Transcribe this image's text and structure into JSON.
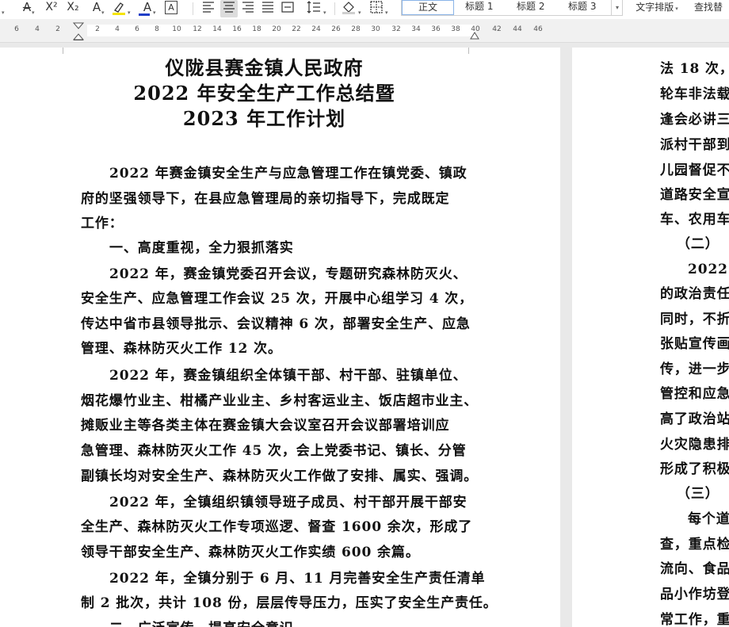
{
  "toolbar": {
    "strikethrough_label": "A",
    "superscript_label": "X²",
    "subscript_label": "X₂",
    "text_effect_label": "A",
    "highlight_label": "A",
    "font_color_label": "A",
    "char_border_label": "A",
    "styles": [
      "正文",
      "标题 1",
      "标题 2",
      "标题 3"
    ],
    "active_style": "正文",
    "text_layout_label": "文字排版",
    "find_replace_label": "查找替",
    "highlight_color": "#f5e400",
    "font_color": "#1f3ec7"
  },
  "ruler": {
    "labels": [
      "6",
      "4",
      "2",
      "2",
      "4",
      "6",
      "8",
      "10",
      "12",
      "14",
      "16",
      "18",
      "20",
      "22",
      "24",
      "26",
      "28",
      "30",
      "32",
      "34",
      "36",
      "38",
      "40",
      "42",
      "44",
      "46"
    ]
  },
  "document": {
    "page1": {
      "title_lines": [
        "仪陇县赛金镇人民政府",
        "2022 年安全生产工作总结暨",
        "2023 年工作计划"
      ],
      "lines": [
        "2022 年赛金镇安全生产与应急管理工作在镇党委、镇政",
        "府的坚强领导下，在县应急管理局的亲切指导下，完成既定",
        "工作：",
        "一、高度重视，全力狠抓落实",
        "2022 年，赛金镇党委召开会议，专题研究森林防灭火、",
        "安全生产、应急管理工作会议 25 次，开展中心组学习 4 次，",
        "传达中省市县领导批示、会议精神 6 次，部署安全生产、应急",
        "管理、森林防灭火工作 12 次。",
        "2022 年，赛金镇组织全体镇干部、村干部、驻镇单位、",
        "烟花爆竹业主、柑橘产业业主、乡村客运业主、饭店超市业主、",
        "摊贩业主等各类主体在赛金镇大会议室召开会议部署培训应",
        "急管理、森林防灭火工作 45 次，会上党委书记、镇长、分管",
        "副镇长均对安全生产、森林防灭火工作做了安排、属实、强调。",
        "2022 年，全镇组织镇领导班子成员、村干部开展干部安",
        "全生产、森林防灭火工作专项巡逻、督查 1600 余次，形成了",
        "领导干部安全生产、森林防灭火工作实绩 600 余篇。",
        "2022 年，全镇分别于 6 月、11 月完善安全生产责任清单",
        "制 2 批次，共计 108 份，层层传导压力，压实了安全生产责任。",
        "二、广泛宣传，提高安全意识"
      ]
    },
    "page2": {
      "lines": [
        "法 18 次，",
        "轮车非法载",
        "逢会必讲三",
        "派村干部到",
        "儿园督促不",
        "道路安全宣",
        "车、农用车",
        "（二）",
        "2022 年",
        "的政治责任",
        "同时，不折",
        "张贴宣传画",
        "传，进一步",
        "管控和应急",
        "高了政治站",
        "火灾隐患排",
        "形成了积极",
        "（三）",
        "每个道",
        "查，重点检",
        "流向、食品",
        "品小作坊登",
        "常工作，重"
      ]
    }
  }
}
